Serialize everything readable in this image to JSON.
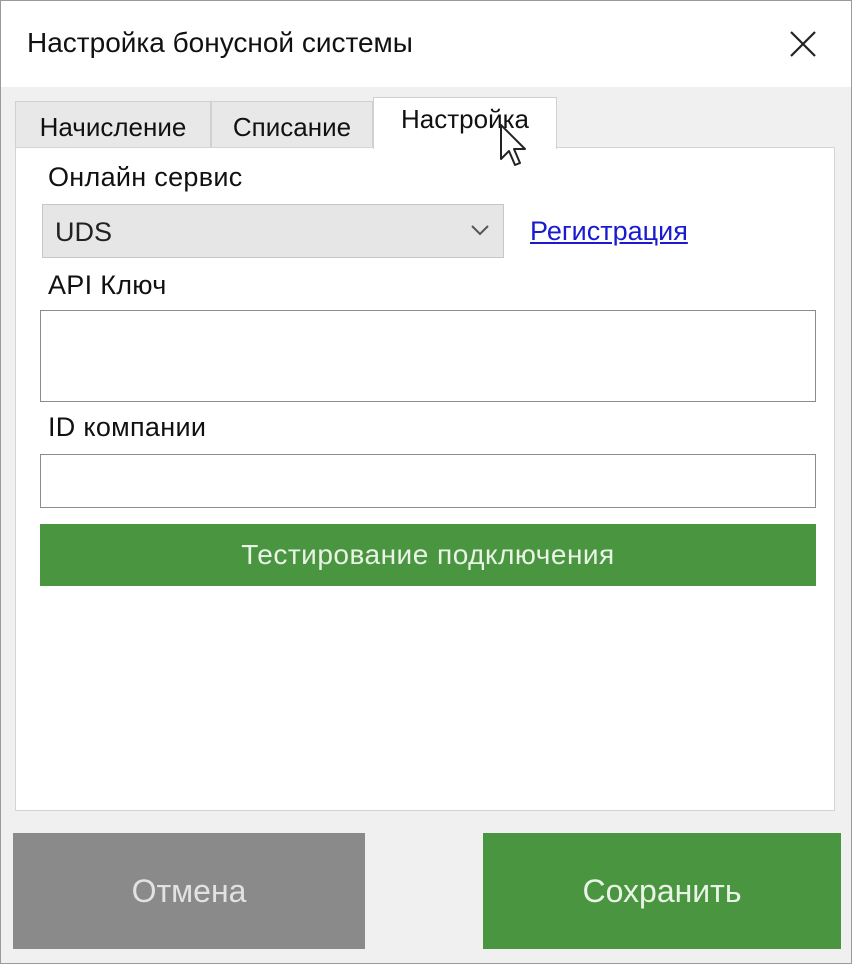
{
  "window": {
    "title": "Настройка бонусной системы",
    "close_icon": "close-icon"
  },
  "tabs": [
    {
      "label": "Начисление",
      "active": false
    },
    {
      "label": "Списание",
      "active": false
    },
    {
      "label": "Настройка",
      "active": true
    }
  ],
  "settings": {
    "service_label": "Онлайн сервис",
    "service_value": "UDS",
    "register_link": "Регистрация",
    "api_key_label": "API Ключ",
    "api_key_value": "",
    "company_id_label": "ID компании",
    "company_id_value": "",
    "test_button": "Тестирование подключения"
  },
  "footer": {
    "cancel_label": "Отмена",
    "save_label": "Сохранить"
  },
  "colors": {
    "accent_green": "#4a9640",
    "cancel_gray": "#8a8a8a",
    "link_blue": "#1a1ad0"
  }
}
